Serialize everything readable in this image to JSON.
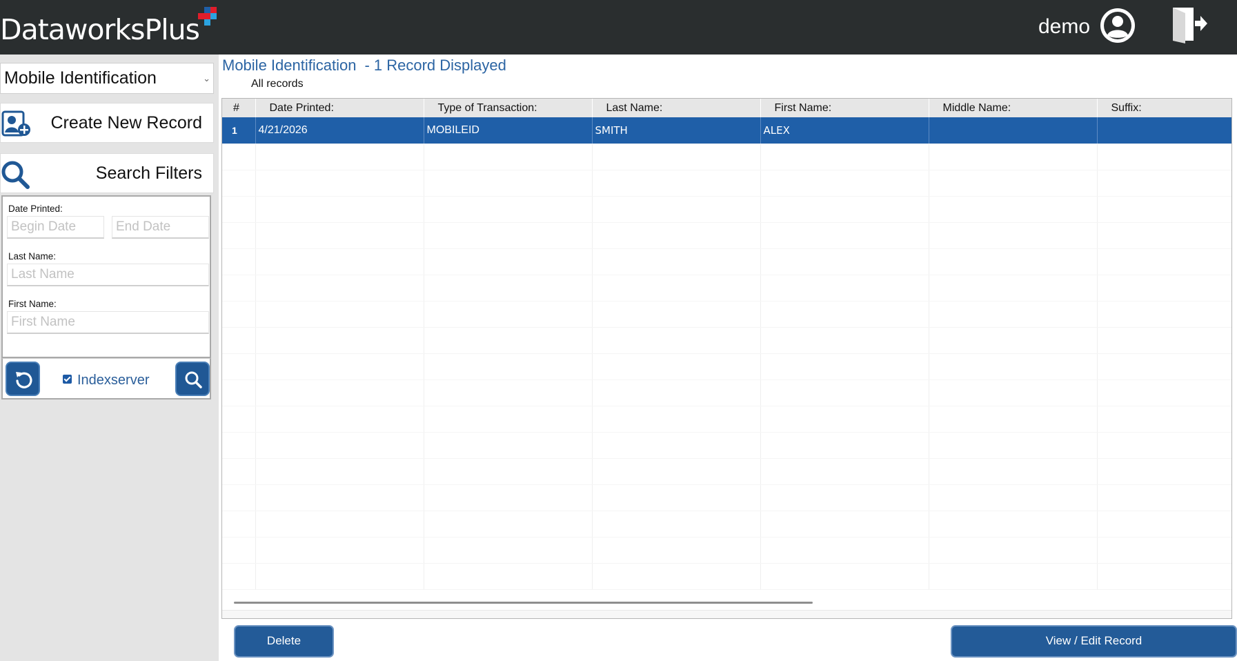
{
  "header": {
    "logo_text": "DataworksPlus",
    "username": "demo",
    "icons": {
      "user": "user-circle-icon",
      "logout": "logout-door-icon"
    },
    "logo_colors": [
      "#e11d2a",
      "#1f5fa8",
      "#2ba3e0"
    ]
  },
  "sidebar": {
    "module_select": {
      "value": "Mobile Identification"
    },
    "create_button": {
      "label": "Create New Record",
      "icon": "add-user-icon"
    },
    "search_button": {
      "label": "Search Filters",
      "icon": "search-icon"
    },
    "filters": {
      "date_printed_label": "Date Printed:",
      "begin_date_placeholder": "Begin Date",
      "end_date_placeholder": "End Date",
      "last_name_label": "Last Name:",
      "last_name_placeholder": "Last Name",
      "first_name_label": "First Name:",
      "first_name_placeholder": "First Name",
      "indexserver_label": "Indexserver",
      "indexserver_checked": true
    }
  },
  "main": {
    "title": "Mobile Identification",
    "count_text": "- 1 Record Displayed",
    "subtitle": "All records",
    "columns": [
      "#",
      "Date Printed:",
      "Type of Transaction:",
      "Last Name:",
      "First Name:",
      "Middle Name:",
      "Suffix:"
    ],
    "rows": [
      {
        "num": "1",
        "date_printed": "4/21/2026",
        "type": "MOBILEID",
        "last_name": "SMITH",
        "first_name": "ALEX",
        "middle_name": "",
        "suffix": ""
      }
    ],
    "delete_label": "Delete",
    "view_edit_label": "View / Edit Record"
  },
  "colors": {
    "header_bg": "#2a2e2f",
    "accent": "#1f5fa8",
    "sidebar_bg": "#e4e4e4"
  }
}
